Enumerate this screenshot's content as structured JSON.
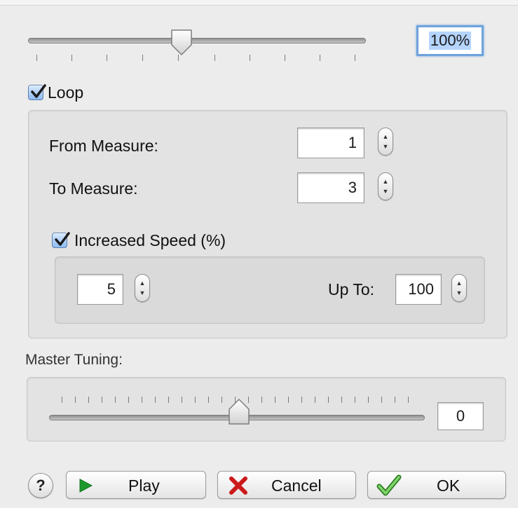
{
  "speed": {
    "value_text": "100%",
    "slider_level_percent": 45
  },
  "loop": {
    "checkbox_label": "Loop",
    "checked": true,
    "from_label": "From Measure:",
    "from_value": "1",
    "to_label": "To Measure:",
    "to_value": "3",
    "increased_speed": {
      "checkbox_label": "Increased Speed (%)",
      "checked": true,
      "start_value": "5",
      "up_to_label": "Up To:",
      "up_to_value": "100"
    }
  },
  "master_tuning": {
    "label": "Master Tuning:",
    "value": "0",
    "slider_level_percent": 50
  },
  "buttons": {
    "help": "?",
    "play": "Play",
    "cancel": "Cancel",
    "ok": "OK"
  },
  "colors": {
    "play_icon": "#1e9a2c",
    "cancel_icon": "#cc1a1a",
    "ok_icon": "#4aa83a",
    "focus_ring": "#6fa3dc",
    "selection": "#b5d5ff"
  },
  "icons": {
    "play": "play-triangle-icon",
    "cancel": "red-x-icon",
    "ok": "green-checkmark-icon",
    "stepper": "up-down-arrows-icon"
  }
}
